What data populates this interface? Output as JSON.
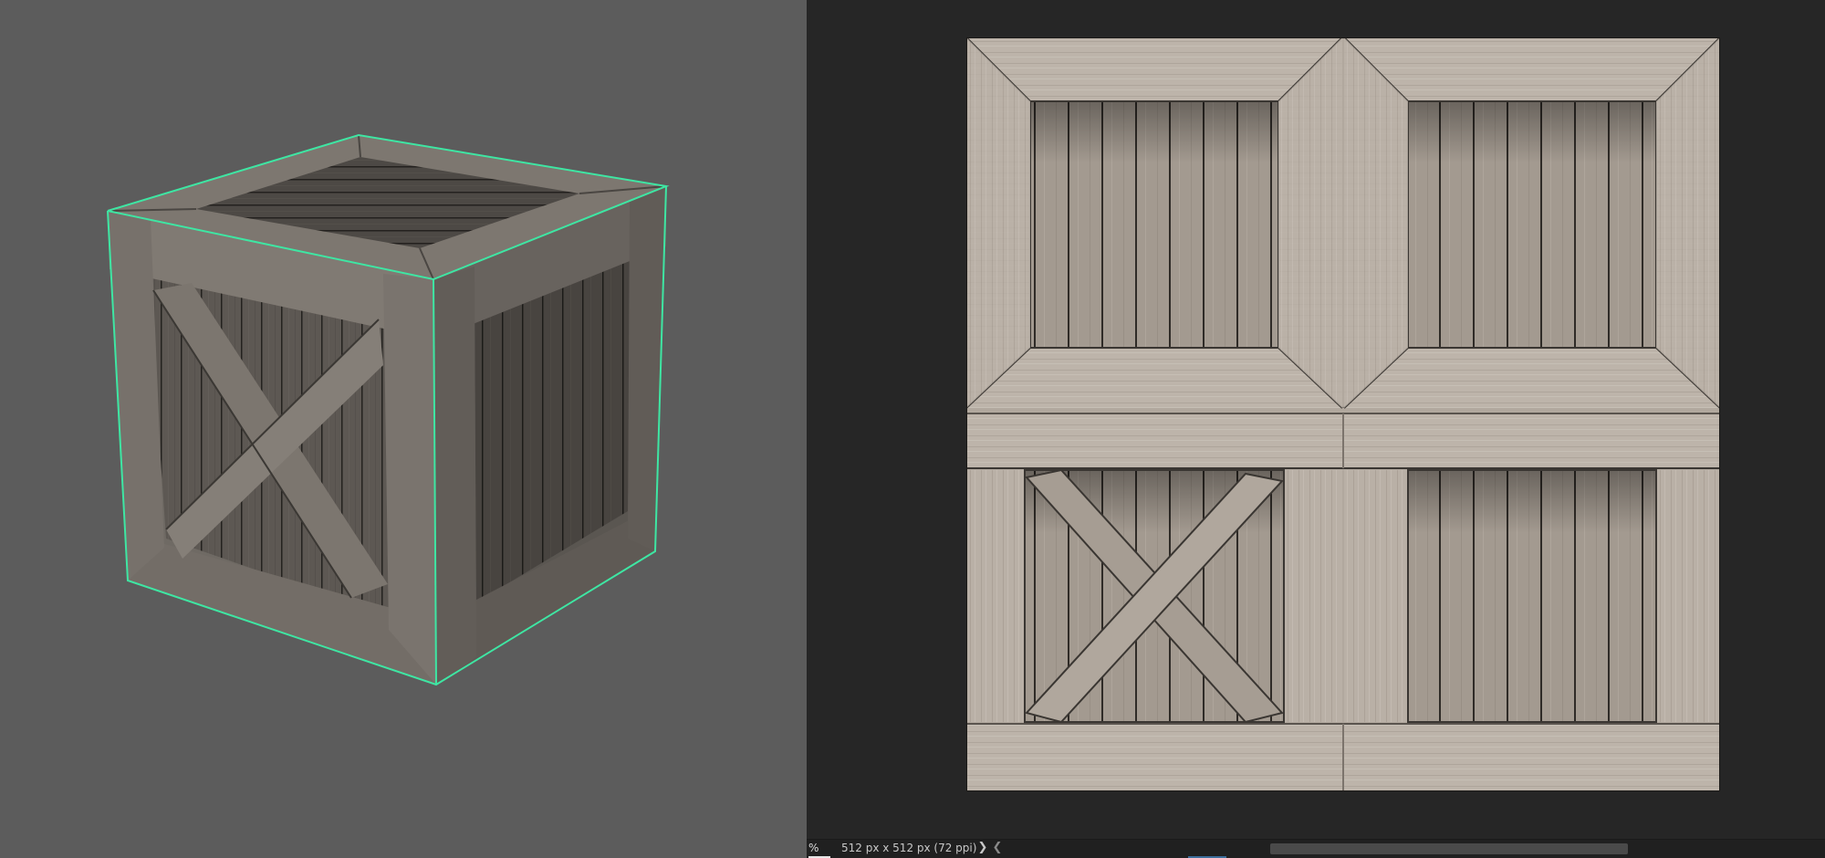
{
  "viewport3d": {
    "background": "#5c5c5c",
    "selection_color": "#3ee6a3",
    "object": "wooden-crate"
  },
  "texture_view": {
    "background": "#262626",
    "texture": "wooden-crate-diffuse"
  },
  "statusbar": {
    "zoom_text": "%",
    "doc_info": "512 px x 512 px (72 ppi)",
    "nav_next": "❯",
    "nav_prev": "❮"
  }
}
